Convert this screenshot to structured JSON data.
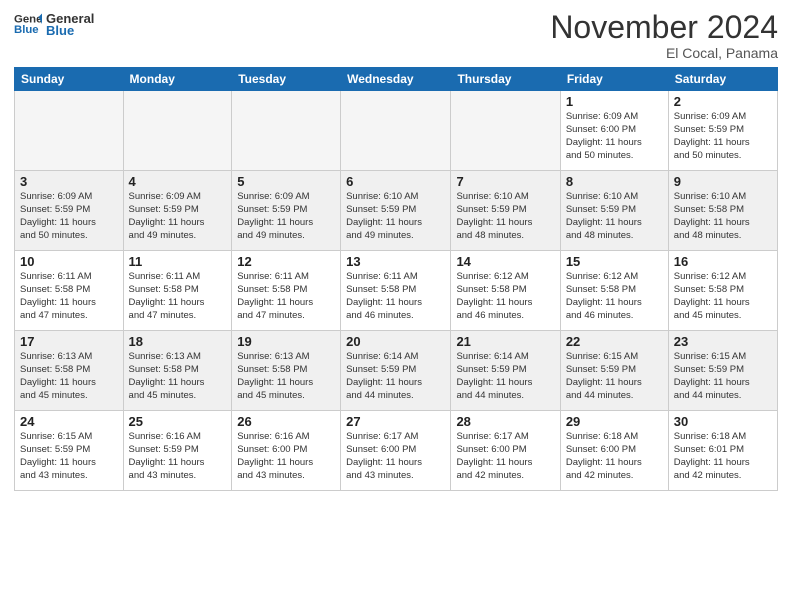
{
  "logo": {
    "general": "General",
    "blue": "Blue"
  },
  "title": "November 2024",
  "location": "El Cocal, Panama",
  "headers": [
    "Sunday",
    "Monday",
    "Tuesday",
    "Wednesday",
    "Thursday",
    "Friday",
    "Saturday"
  ],
  "weeks": [
    [
      {
        "day": "",
        "info": ""
      },
      {
        "day": "",
        "info": ""
      },
      {
        "day": "",
        "info": ""
      },
      {
        "day": "",
        "info": ""
      },
      {
        "day": "",
        "info": ""
      },
      {
        "day": "1",
        "info": "Sunrise: 6:09 AM\nSunset: 6:00 PM\nDaylight: 11 hours\nand 50 minutes."
      },
      {
        "day": "2",
        "info": "Sunrise: 6:09 AM\nSunset: 5:59 PM\nDaylight: 11 hours\nand 50 minutes."
      }
    ],
    [
      {
        "day": "3",
        "info": "Sunrise: 6:09 AM\nSunset: 5:59 PM\nDaylight: 11 hours\nand 50 minutes."
      },
      {
        "day": "4",
        "info": "Sunrise: 6:09 AM\nSunset: 5:59 PM\nDaylight: 11 hours\nand 49 minutes."
      },
      {
        "day": "5",
        "info": "Sunrise: 6:09 AM\nSunset: 5:59 PM\nDaylight: 11 hours\nand 49 minutes."
      },
      {
        "day": "6",
        "info": "Sunrise: 6:10 AM\nSunset: 5:59 PM\nDaylight: 11 hours\nand 49 minutes."
      },
      {
        "day": "7",
        "info": "Sunrise: 6:10 AM\nSunset: 5:59 PM\nDaylight: 11 hours\nand 48 minutes."
      },
      {
        "day": "8",
        "info": "Sunrise: 6:10 AM\nSunset: 5:59 PM\nDaylight: 11 hours\nand 48 minutes."
      },
      {
        "day": "9",
        "info": "Sunrise: 6:10 AM\nSunset: 5:58 PM\nDaylight: 11 hours\nand 48 minutes."
      }
    ],
    [
      {
        "day": "10",
        "info": "Sunrise: 6:11 AM\nSunset: 5:58 PM\nDaylight: 11 hours\nand 47 minutes."
      },
      {
        "day": "11",
        "info": "Sunrise: 6:11 AM\nSunset: 5:58 PM\nDaylight: 11 hours\nand 47 minutes."
      },
      {
        "day": "12",
        "info": "Sunrise: 6:11 AM\nSunset: 5:58 PM\nDaylight: 11 hours\nand 47 minutes."
      },
      {
        "day": "13",
        "info": "Sunrise: 6:11 AM\nSunset: 5:58 PM\nDaylight: 11 hours\nand 46 minutes."
      },
      {
        "day": "14",
        "info": "Sunrise: 6:12 AM\nSunset: 5:58 PM\nDaylight: 11 hours\nand 46 minutes."
      },
      {
        "day": "15",
        "info": "Sunrise: 6:12 AM\nSunset: 5:58 PM\nDaylight: 11 hours\nand 46 minutes."
      },
      {
        "day": "16",
        "info": "Sunrise: 6:12 AM\nSunset: 5:58 PM\nDaylight: 11 hours\nand 45 minutes."
      }
    ],
    [
      {
        "day": "17",
        "info": "Sunrise: 6:13 AM\nSunset: 5:58 PM\nDaylight: 11 hours\nand 45 minutes."
      },
      {
        "day": "18",
        "info": "Sunrise: 6:13 AM\nSunset: 5:58 PM\nDaylight: 11 hours\nand 45 minutes."
      },
      {
        "day": "19",
        "info": "Sunrise: 6:13 AM\nSunset: 5:58 PM\nDaylight: 11 hours\nand 45 minutes."
      },
      {
        "day": "20",
        "info": "Sunrise: 6:14 AM\nSunset: 5:59 PM\nDaylight: 11 hours\nand 44 minutes."
      },
      {
        "day": "21",
        "info": "Sunrise: 6:14 AM\nSunset: 5:59 PM\nDaylight: 11 hours\nand 44 minutes."
      },
      {
        "day": "22",
        "info": "Sunrise: 6:15 AM\nSunset: 5:59 PM\nDaylight: 11 hours\nand 44 minutes."
      },
      {
        "day": "23",
        "info": "Sunrise: 6:15 AM\nSunset: 5:59 PM\nDaylight: 11 hours\nand 44 minutes."
      }
    ],
    [
      {
        "day": "24",
        "info": "Sunrise: 6:15 AM\nSunset: 5:59 PM\nDaylight: 11 hours\nand 43 minutes."
      },
      {
        "day": "25",
        "info": "Sunrise: 6:16 AM\nSunset: 5:59 PM\nDaylight: 11 hours\nand 43 minutes."
      },
      {
        "day": "26",
        "info": "Sunrise: 6:16 AM\nSunset: 6:00 PM\nDaylight: 11 hours\nand 43 minutes."
      },
      {
        "day": "27",
        "info": "Sunrise: 6:17 AM\nSunset: 6:00 PM\nDaylight: 11 hours\nand 43 minutes."
      },
      {
        "day": "28",
        "info": "Sunrise: 6:17 AM\nSunset: 6:00 PM\nDaylight: 11 hours\nand 42 minutes."
      },
      {
        "day": "29",
        "info": "Sunrise: 6:18 AM\nSunset: 6:00 PM\nDaylight: 11 hours\nand 42 minutes."
      },
      {
        "day": "30",
        "info": "Sunrise: 6:18 AM\nSunset: 6:01 PM\nDaylight: 11 hours\nand 42 minutes."
      }
    ]
  ]
}
